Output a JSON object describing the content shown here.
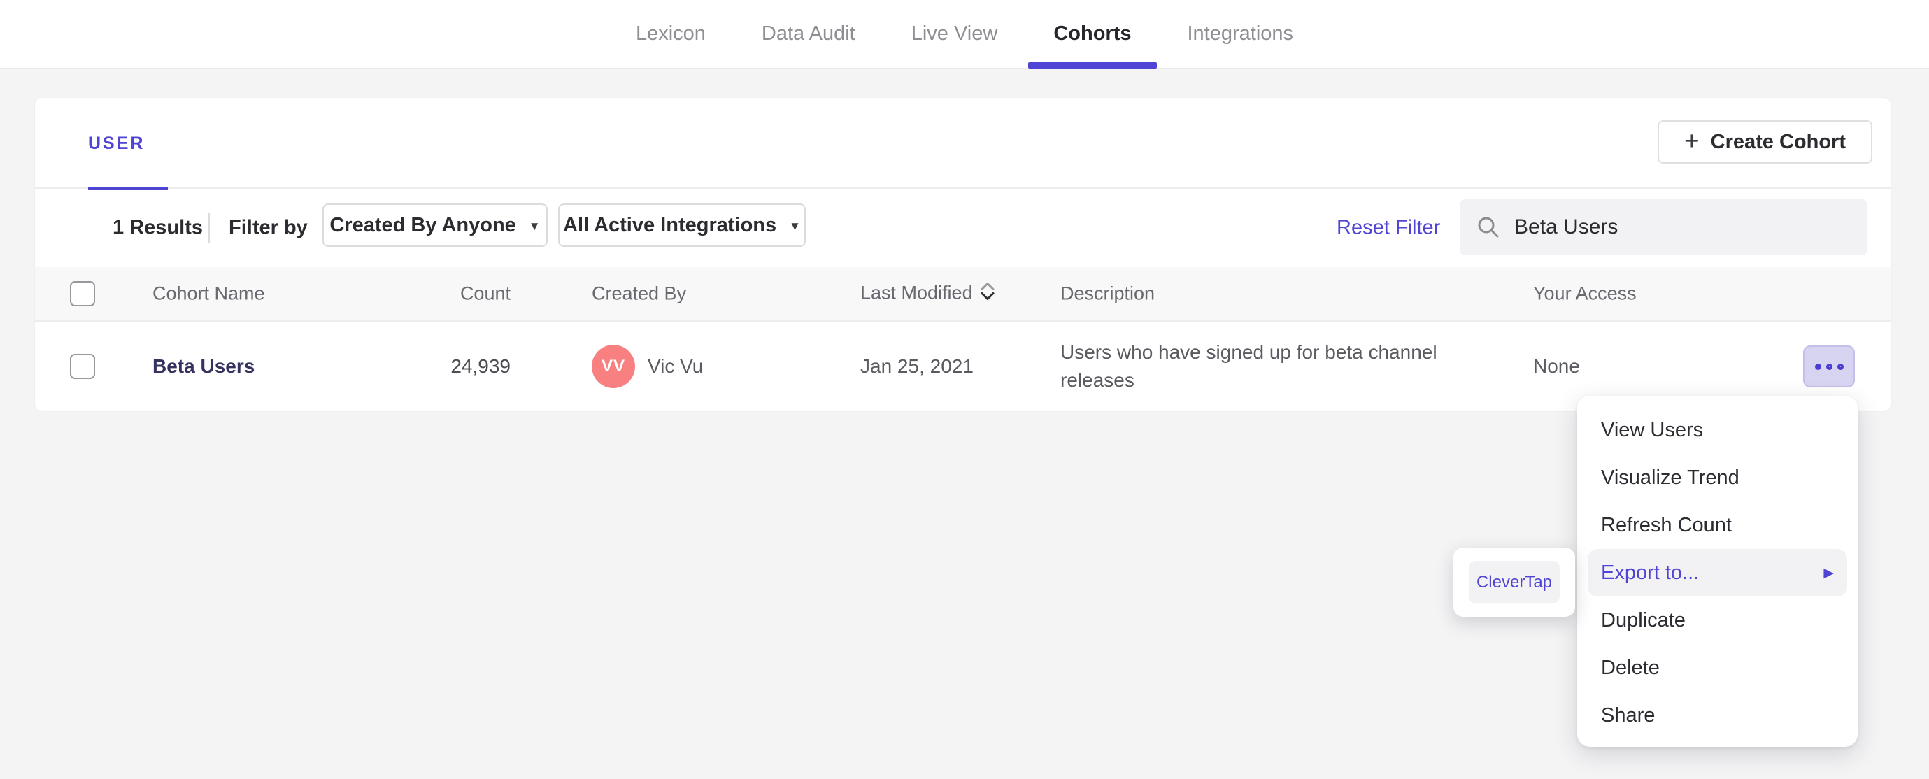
{
  "nav": {
    "tabs": [
      {
        "label": "Lexicon",
        "active": false
      },
      {
        "label": "Data Audit",
        "active": false
      },
      {
        "label": "Live View",
        "active": false
      },
      {
        "label": "Cohorts",
        "active": true
      },
      {
        "label": "Integrations",
        "active": false
      }
    ]
  },
  "cohorts_panel": {
    "tab_label": "USER",
    "create_cohort": {
      "plus_icon": "+",
      "label": "Create Cohort"
    },
    "filter_bar": {
      "results": "1 Results",
      "filter_by": "Filter by",
      "created_by_dropdown": {
        "label": "Created By Anyone",
        "caret_icon": "▼"
      },
      "integrations_dropdown": {
        "label": "All Active Integrations",
        "caret_icon": "▼"
      },
      "reset_filter": "Reset Filter",
      "search": {
        "value": "Beta Users"
      }
    },
    "table": {
      "headers": {
        "cohort_name": "Cohort Name",
        "count": "Count",
        "created_by": "Created By",
        "last_modified": "Last Modified",
        "description": "Description",
        "your_access": "Your Access"
      },
      "row": {
        "cohort_name": "Beta Users",
        "count": "24,939",
        "created_by": {
          "avatar_initials": "VV",
          "name": "Vic Vu"
        },
        "last_modified": "Jan 25, 2021",
        "description": "Users who have signed up for beta channel releases",
        "your_access": "None"
      }
    }
  },
  "context_menu": {
    "items": [
      {
        "label": "View Users"
      },
      {
        "label": "Visualize Trend"
      },
      {
        "label": "Refresh Count"
      },
      {
        "label": "Export to...",
        "highlighted": true,
        "arrow_icon": "▶"
      },
      {
        "label": "Duplicate"
      },
      {
        "label": "Delete"
      },
      {
        "label": "Share"
      }
    ]
  },
  "export_submenu": {
    "items": [
      {
        "label": "CleverTap"
      }
    ]
  },
  "colors": {
    "accent_purple": "#5044d4",
    "cohort_link": "#35325f",
    "avatar_coral": "#f88080",
    "page_background": "#f4f4f5",
    "table_header_background": "#f8f8f9",
    "ellipsis_button_background": "#d7d4f2"
  }
}
